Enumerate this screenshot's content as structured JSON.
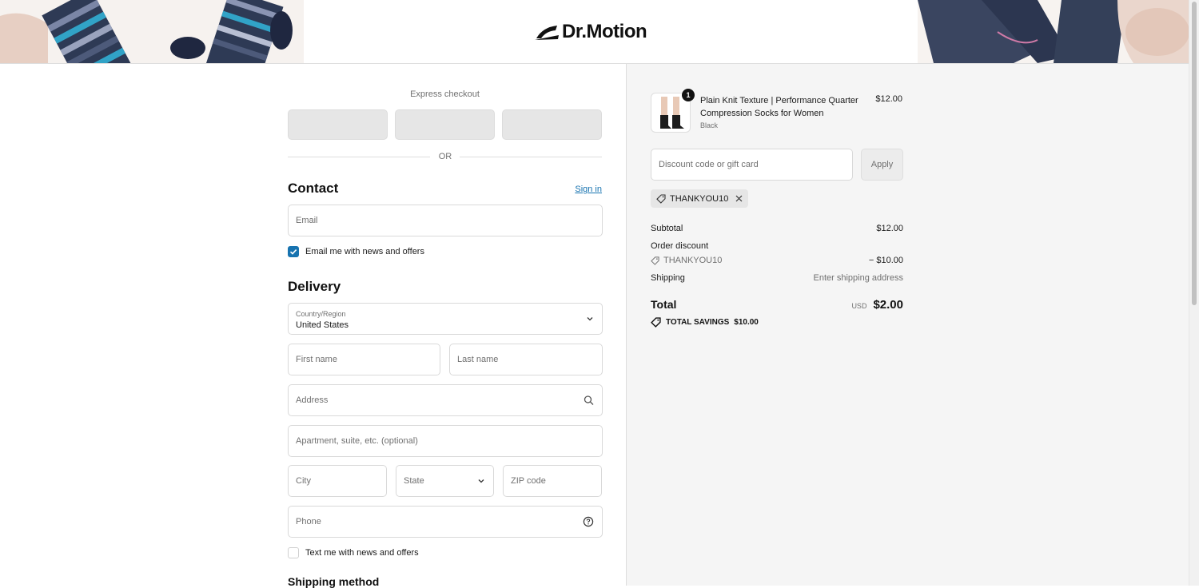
{
  "header": {
    "brand": "Dr.Motion"
  },
  "express": {
    "label": "Express checkout",
    "or_label": "OR"
  },
  "contact": {
    "title": "Contact",
    "signin_label": "Sign in",
    "email_placeholder": "Email",
    "newsletter_label": "Email me with news and offers",
    "newsletter_checked": true
  },
  "delivery": {
    "title": "Delivery",
    "country_label": "Country/Region",
    "country_value": "United States",
    "first_name_placeholder": "First name",
    "last_name_placeholder": "Last name",
    "address_placeholder": "Address",
    "apartment_placeholder": "Apartment, suite, etc. (optional)",
    "city_placeholder": "City",
    "state_placeholder": "State",
    "zip_placeholder": "ZIP code",
    "phone_placeholder": "Phone",
    "sms_label": "Text me with news and offers",
    "sms_checked": false
  },
  "shipping_method": {
    "title": "Shipping method"
  },
  "summary": {
    "item": {
      "quantity": "1",
      "name": "Plain Knit Texture | Performance Quarter Compression Socks for Women",
      "variant": "Black",
      "price": "$12.00"
    },
    "discount_placeholder": "Discount code or gift card",
    "apply_label": "Apply",
    "applied_code": "THANKYOU10",
    "subtotal_label": "Subtotal",
    "subtotal_value": "$12.00",
    "order_discount_label": "Order discount",
    "discount_code": "THANKYOU10",
    "discount_value": "− $10.00",
    "shipping_label": "Shipping",
    "shipping_value": "Enter shipping address",
    "total_label": "Total",
    "currency": "USD",
    "total_value": "$2.00",
    "savings_label": "TOTAL SAVINGS",
    "savings_value": "$10.00"
  },
  "colors": {
    "link": "#1773b0",
    "checkbox": "#1773b0",
    "summary_bg": "#f5f5f5"
  }
}
